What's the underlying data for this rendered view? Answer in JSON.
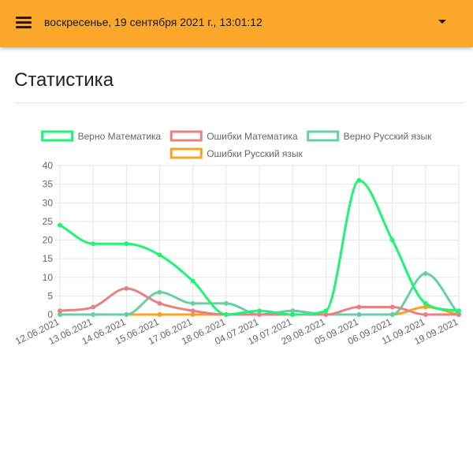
{
  "header": {
    "datetime": "воскресенье, 19 сентября 2021 г., 13:01:12",
    "menu_icon": "hamburger-menu-icon",
    "dropdown_icon": "caret-down-icon",
    "background_color": "#fba72a"
  },
  "page": {
    "title": "Статистика"
  },
  "chart_data": {
    "type": "line",
    "categories": [
      "12.06.2021",
      "13.06.2021",
      "14.06.2021",
      "15.06.2021",
      "17.06.2021",
      "18.06.2021",
      "04.07.2021",
      "19.07.2021",
      "29.08.2021",
      "05.09.2021",
      "06.09.2021",
      "11.09.2021",
      "19.09.2021"
    ],
    "series": [
      {
        "name": "Верно Математика",
        "color": "#1ff574",
        "values": [
          24,
          19,
          19,
          16,
          9,
          0,
          1,
          0,
          1,
          36,
          20,
          3,
          1
        ]
      },
      {
        "name": "Ошибки Математика",
        "color": "#e88282",
        "values": [
          1,
          2,
          7,
          3,
          1,
          0,
          0,
          0,
          0,
          2,
          2,
          0,
          0
        ]
      },
      {
        "name": "Верно Русский язык",
        "color": "#66cfa6",
        "values": [
          0,
          0,
          0,
          6,
          3,
          3,
          0,
          1,
          0,
          0,
          0,
          11,
          0
        ]
      },
      {
        "name": "Ошибки Русский язык",
        "color": "#f7a323",
        "values": [
          0,
          0,
          0,
          0,
          0,
          0,
          0,
          0,
          0,
          0,
          0,
          2,
          0
        ]
      }
    ],
    "ylim": [
      0,
      40
    ],
    "yticks": [
      "0",
      "5",
      "10",
      "15",
      "20",
      "25",
      "30",
      "35",
      "40"
    ],
    "grid": true,
    "legend_position": "top"
  }
}
